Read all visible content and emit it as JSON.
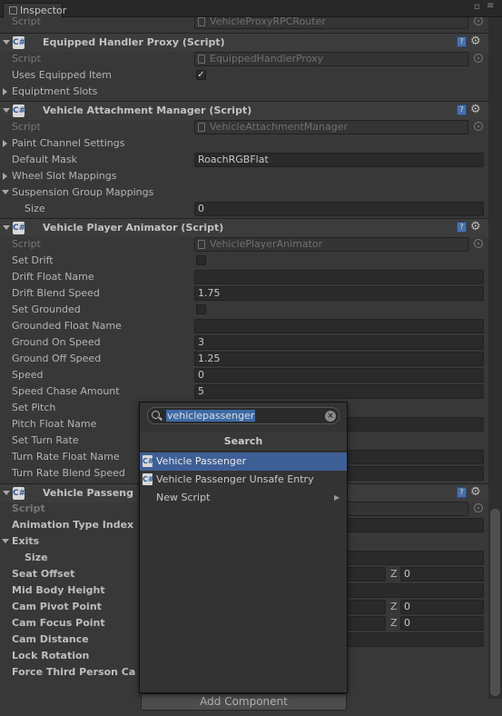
{
  "tab": {
    "label": "Inspector",
    "lock_icon": "lock-icon",
    "menu_icon": "menu-icon"
  },
  "top_script_row": {
    "label": "Script",
    "value": "VehicleProxyRPCRouter"
  },
  "components": [
    {
      "title": "Equipped Handler Proxy (Script)",
      "script_label": "Script",
      "script_value": "EquippedHandlerProxy",
      "fields": [
        {
          "label": "Uses Equipped Item",
          "checked": "✓"
        },
        {
          "label": "Equiptment Slots"
        }
      ]
    },
    {
      "title": "Vehicle Attachment Manager (Script)",
      "script_label": "Script",
      "script_value": "VehicleAttachmentManager",
      "fields": [
        {
          "label": "Paint Channel Settings"
        },
        {
          "label": "Default Mask",
          "value": "RoachRGBFlat"
        },
        {
          "label": "Wheel Slot Mappings"
        },
        {
          "label": "Suspension Group Mappings"
        },
        {
          "label": "Size",
          "value": "0"
        }
      ]
    },
    {
      "title": "Vehicle Player Animator (Script)",
      "script_label": "Script",
      "script_value": "VehiclePlayerAnimator",
      "fields": [
        {
          "label": "Set Drift"
        },
        {
          "label": "Drift Float Name",
          "value": ""
        },
        {
          "label": "Drift Blend Speed",
          "value": "1.75"
        },
        {
          "label": "Set Grounded"
        },
        {
          "label": "Grounded Float Name",
          "value": ""
        },
        {
          "label": "Ground On Speed",
          "value": "3"
        },
        {
          "label": "Ground Off Speed",
          "value": "1.25"
        },
        {
          "label": "Speed",
          "value": "0"
        },
        {
          "label": "Speed Chase Amount",
          "value": "5"
        },
        {
          "label": "Set Pitch"
        },
        {
          "label": "Pitch Float Name"
        },
        {
          "label": "Set Turn Rate"
        },
        {
          "label": "Turn Rate Float Name"
        },
        {
          "label": "Turn Rate Blend Speed"
        }
      ]
    },
    {
      "title": "Vehicle Passeng",
      "script_label": "Script",
      "fields": [
        {
          "label": "Animation Type Index"
        },
        {
          "label": "Exits"
        },
        {
          "label": "Size"
        },
        {
          "label": "Seat Offset",
          "z_label": "Z",
          "z_value": "0"
        },
        {
          "label": "Mid Body Height"
        },
        {
          "label": "Cam Pivot Point",
          "z_label": "Z",
          "z_value": "0"
        },
        {
          "label": "Cam Focus Point",
          "z_label": "Z",
          "z_value": "0"
        },
        {
          "label": "Cam Distance"
        },
        {
          "label": "Lock Rotation"
        },
        {
          "label": "Force Third Person Ca"
        }
      ]
    }
  ],
  "popup": {
    "search_value": "vehiclepassenger",
    "title": "Search",
    "items": [
      {
        "label": "Vehicle Passenger",
        "selected": true
      },
      {
        "label": "Vehicle Passenger Unsafe Entry",
        "selected": false
      },
      {
        "label": "New Script",
        "has_submenu": true
      }
    ]
  },
  "add_component_label": "Add Component",
  "colors": {
    "accent": "#3e5f96",
    "background": "#383838",
    "field": "#2a2a2a"
  }
}
